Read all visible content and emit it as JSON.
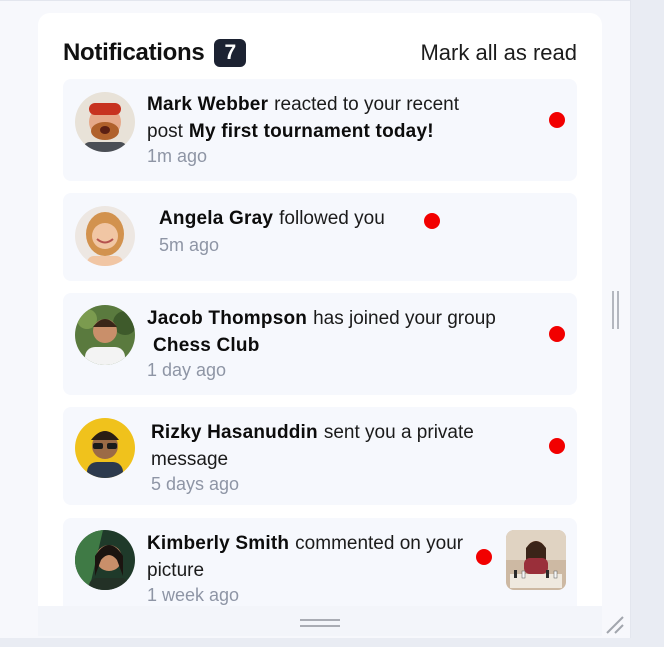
{
  "header": {
    "title": "Notifications",
    "unread_count": "7",
    "mark_all_label": "Mark all as read"
  },
  "notifications": [
    {
      "name": "Mark Webber",
      "action": "reacted to your recent post",
      "target": "My first tournament today!",
      "time": "1m ago",
      "unread": true
    },
    {
      "name": "Angela Gray",
      "action": "followed you",
      "target": "",
      "time": "5m ago",
      "unread": true
    },
    {
      "name": "Jacob Thompson",
      "action": "has joined your group",
      "target": "Chess Club",
      "time": "1 day ago",
      "unread": true
    },
    {
      "name": "Rizky Hasanuddin",
      "action": "sent you a private message",
      "target": "",
      "time": "5 days ago",
      "unread": true
    },
    {
      "name": "Kimberly Smith",
      "action": "commented on your picture",
      "target": "",
      "time": "1 week ago",
      "unread": true
    }
  ],
  "colors": {
    "unread_dot": "#f20000",
    "badge_bg": "#1c2232",
    "card_bg": "#f6f8fd",
    "time_text": "#8e95a5"
  }
}
